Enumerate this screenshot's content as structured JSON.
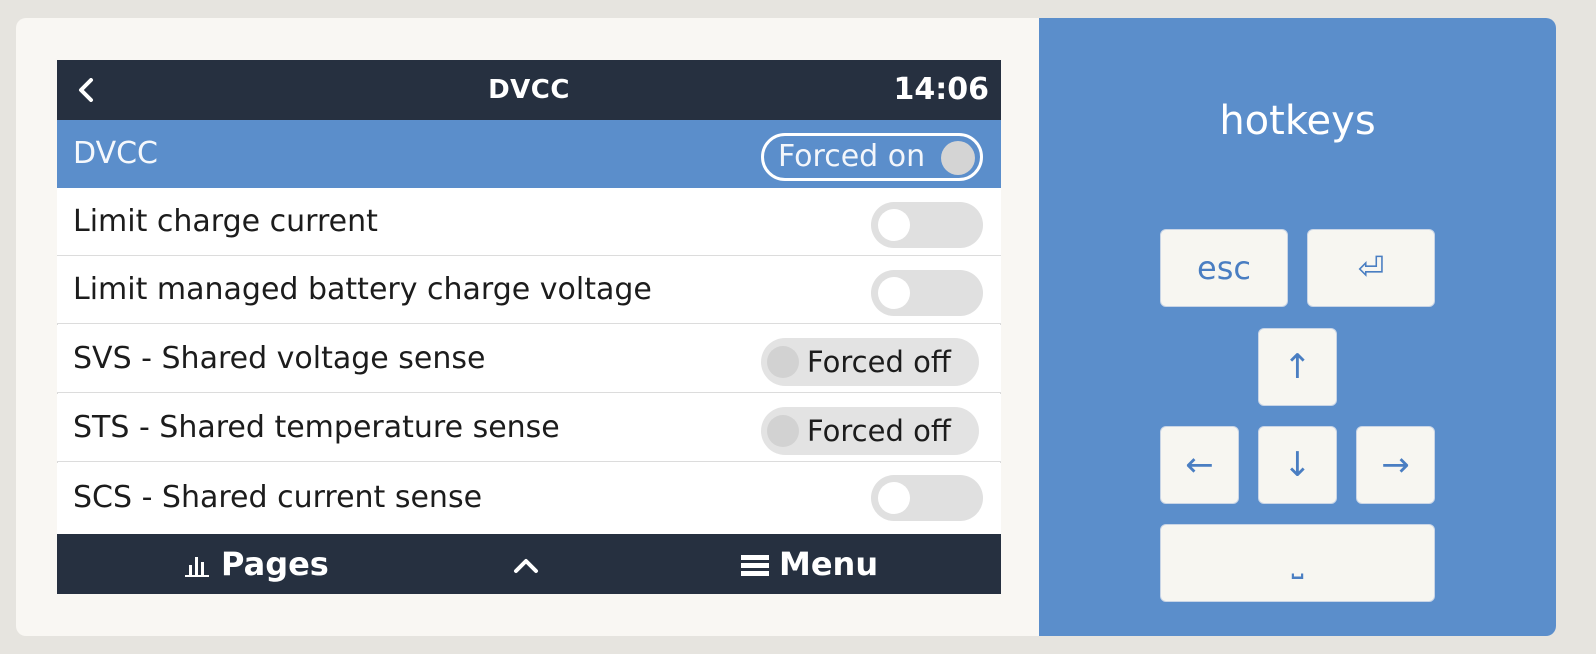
{
  "topbar": {
    "title": "DVCC",
    "time": "14:06"
  },
  "rows": [
    {
      "label": "DVCC",
      "control": "pill-on",
      "value": "Forced on",
      "selected": true
    },
    {
      "label": "Limit charge current",
      "control": "switch",
      "state": "off"
    },
    {
      "label": "Limit managed battery charge voltage",
      "control": "switch",
      "state": "off"
    },
    {
      "label": "SVS - Shared voltage sense",
      "control": "pill-off",
      "value": "Forced off"
    },
    {
      "label": "STS - Shared temperature sense",
      "control": "pill-off",
      "value": "Forced off"
    },
    {
      "label": "SCS - Shared current sense",
      "control": "switch",
      "state": "off"
    }
  ],
  "bottombar": {
    "pages_label": "Pages",
    "menu_label": "Menu"
  },
  "hotkeys": {
    "title": "hotkeys",
    "keys": {
      "esc": "esc",
      "enter": "⏎",
      "up": "↑",
      "left": "←",
      "down": "↓",
      "right": "→",
      "space": "⎵"
    }
  },
  "colors": {
    "accent": "#5b8ecb",
    "bar": "#263040",
    "card": "#f9f7f3"
  }
}
